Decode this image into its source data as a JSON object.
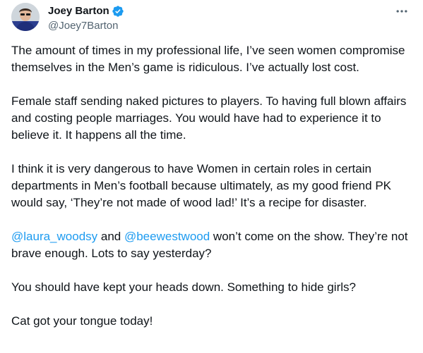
{
  "author": {
    "display_name": "Joey Barton",
    "handle": "@Joey7Barton",
    "verified": true,
    "verified_color": "#1d9bf0"
  },
  "colors": {
    "text": "#0f1419",
    "secondary": "#536471",
    "link": "#1d9bf0"
  },
  "paragraphs": {
    "p1": "The amount of times in my professional life, I’ve seen women compromise themselves in the Men’s game is ridiculous. I’ve actually lost cost.",
    "p2": "Female staff sending naked pictures to players. To having full blown affairs and costing people marriages. You would have had to experience it to believe it. It happens all the time.",
    "p3": "I think it is very dangerous to have Women in certain roles in certain departments in Men’s football because ultimately, as my good friend PK would say, ‘They’re not made of wood lad!’ It’s a recipe for disaster.",
    "p4": {
      "mention1": "@laura_woodsy",
      "and": " and ",
      "mention2": "@beewestwood",
      "rest": " won’t come on the show. They’re not brave enough. Lots to say yesterday?"
    },
    "p5": "You should have kept your heads down. Something to hide girls?",
    "p6": "Cat got your tongue today!"
  },
  "icons": {
    "more": "more-horizontal-icon",
    "verified": "verified-badge-icon"
  }
}
